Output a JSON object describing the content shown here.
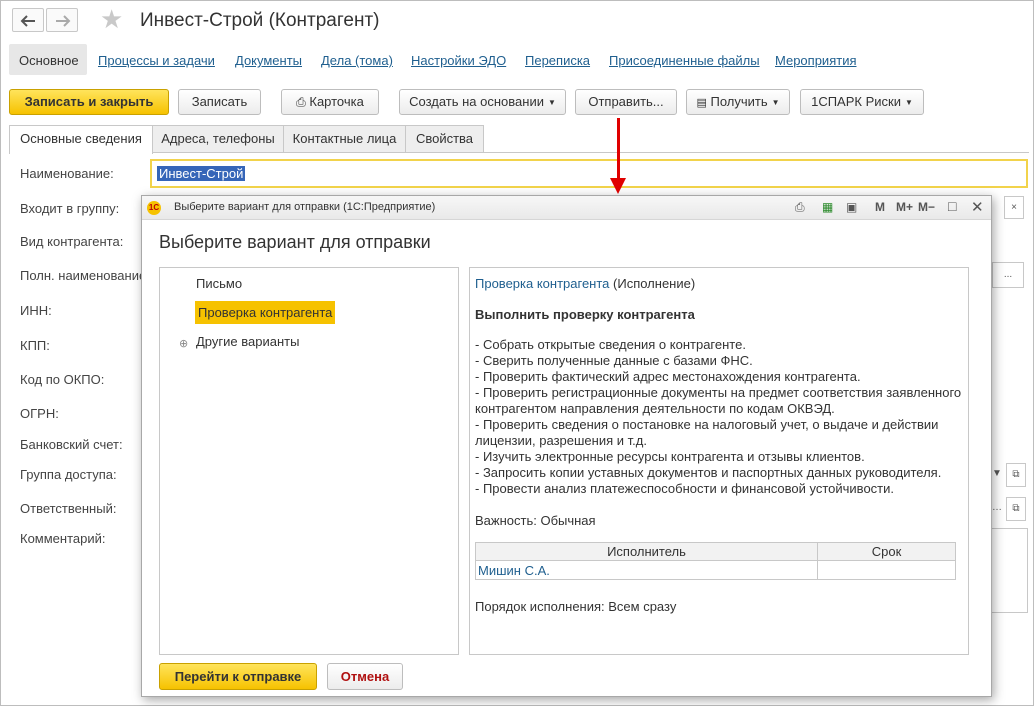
{
  "window": {
    "title": "Инвест-Строй (Контрагент)"
  },
  "nav": {
    "current": "Основное",
    "links": [
      "Процессы и задачи",
      "Документы",
      "Дела (тома)",
      "Настройки ЭДО",
      "Переписка",
      "Присоединенные файлы",
      "Мероприятия"
    ]
  },
  "toolbar": {
    "save_close": "Записать и закрыть",
    "save": "Записать",
    "card": "Карточка",
    "create_based": "Создать на основании",
    "send": "Отправить...",
    "receive": "Получить",
    "spark": "1СПАРК Риски"
  },
  "tabs": [
    "Основные сведения",
    "Адреса, телефоны",
    "Контактные лица",
    "Свойства"
  ],
  "form": {
    "name_label": "Наименование:",
    "name_value": "Инвест-Строй",
    "labels": [
      "Входит в группу:",
      "Вид контрагента:",
      "Полн. наименование",
      "ИНН:",
      "КПП:",
      "Код по ОКПО:",
      "ОГРН:",
      "Банковский счет:",
      "Группа доступа:",
      "Ответственный:",
      "Комментарий:"
    ]
  },
  "dialog": {
    "titlebar": "Выберите вариант для отправки  (1С:Предприятие)",
    "logo": "1С",
    "heading": "Выберите вариант для отправки",
    "tools": [
      "M",
      "M+",
      "M−"
    ],
    "tree": {
      "item1": "Письмо",
      "item2": "Проверка контрагента",
      "item3": "Другие варианты"
    },
    "detail": {
      "link": "Проверка контрагента",
      "status": " (Исполнение)",
      "heading": "Выполнить проверку контрагента",
      "lines": [
        "- Собрать открытые сведения о контрагенте.",
        "- Сверить полученные данные с базами ФНС.",
        "- Проверить фактический адрес местонахождения контрагента.",
        "- Проверить регистрационные документы на предмет соответствия заявленного",
        "контрагентом направления деятельности по кодам ОКВЭД.",
        "- Проверить сведения о постановке на налоговый учет, о выдаче и действии",
        "лицензии, разрешения и т.д.",
        "- Изучить электронные ресурсы контрагента и отзывы клиентов.",
        "- Запросить копии уставных документов и паспортных данных руководителя.",
        "- Провести анализ платежеспособности и финансовой устойчивости."
      ],
      "importance": "Важность: Обычная",
      "table": {
        "col1": "Исполнитель",
        "col2": "Срок",
        "executor": "Мишин С.А.",
        "deadline": ""
      },
      "order": "Порядок исполнения: Всем сразу"
    },
    "buttons": {
      "go": "Перейти к отправке",
      "cancel": "Отмена"
    }
  },
  "colors": {
    "accent_yellow": "#f6c200",
    "link": "#1f5f8f",
    "arrow": "#e00000",
    "cancel_text": "#b01010"
  }
}
